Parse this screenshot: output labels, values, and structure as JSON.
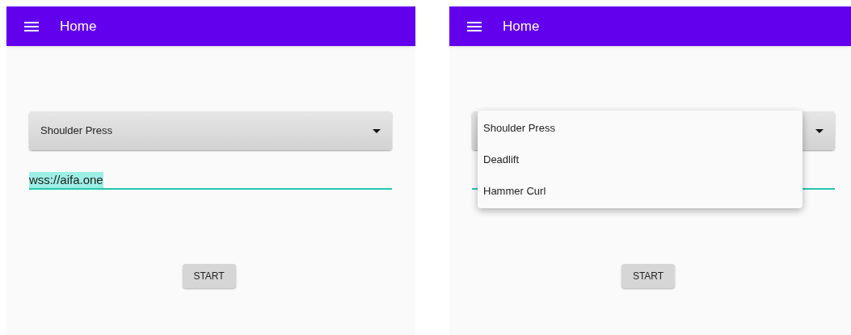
{
  "screens": [
    {
      "app_bar": {
        "title": "Home"
      },
      "spinner": {
        "value": "Shoulder Press"
      },
      "url_field": {
        "value": "wss://aifa.one"
      },
      "start_button": "START"
    },
    {
      "app_bar": {
        "title": "Home"
      },
      "start_button": "START",
      "dropdown": {
        "items": [
          {
            "label": "Shoulder Press",
            "selected": false
          },
          {
            "label": "Deadlift",
            "selected": false
          },
          {
            "label": "Hammer Curl",
            "selected": false
          }
        ]
      }
    }
  ]
}
